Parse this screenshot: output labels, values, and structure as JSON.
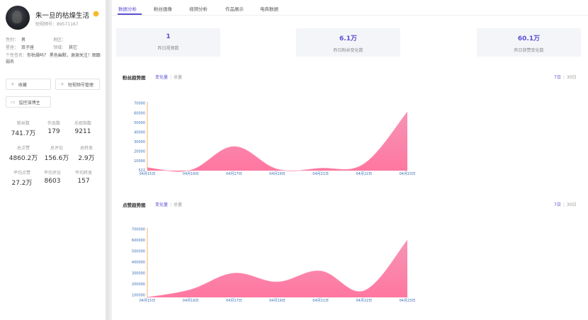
{
  "profile": {
    "nickname": "朱一旦的枯燥生活",
    "account_id": "短视频号：89571167"
  },
  "info": {
    "gender_label": "性别：",
    "gender_value": "男",
    "region_label": "地区：",
    "region_value": "",
    "constellation_label": "星座：",
    "constellation_value": "双子座",
    "field_label": "领域：",
    "field_value": "其它",
    "signature_label": "个性签名：",
    "signature_value": "你枯燥吗？ 黑色幽默，谢谢关注！图跟弱名"
  },
  "buttons": {
    "favorite": "收藏",
    "manage": "短视频号管理",
    "monitor": "监控该博主"
  },
  "stats": [
    {
      "label": "粉丝数",
      "value": "741.7万"
    },
    {
      "label": "作品数",
      "value": "179"
    },
    {
      "label": "乐观指数",
      "value": "9211"
    },
    {
      "label": "总点赞",
      "value": "4860.2万"
    },
    {
      "label": "总评论",
      "value": "156.6万"
    },
    {
      "label": "总转发",
      "value": "2.9万"
    },
    {
      "label": "平均点赞",
      "value": "27.2万"
    },
    {
      "label": "平均评论",
      "value": "8603"
    },
    {
      "label": "平均转发",
      "value": "157"
    }
  ],
  "tabs": [
    {
      "label": "数据分析",
      "active": true
    },
    {
      "label": "粉丝画像",
      "active": false
    },
    {
      "label": "视频分析",
      "active": false
    },
    {
      "label": "作品展示",
      "active": false
    },
    {
      "label": "电商数据",
      "active": false
    }
  ],
  "summary": [
    {
      "value": "1",
      "label": "昨日视频数"
    },
    {
      "value": "6.1万",
      "label": "昨日粉丝变化数"
    },
    {
      "value": "60.1万",
      "label": "昨日获赞变化数"
    }
  ],
  "fans_section": {
    "title": "粉丝趋势图",
    "toggle_on": "变化量",
    "toggle_off": "总量",
    "range_on": "7日",
    "range_off": "30日"
  },
  "likes_section": {
    "title": "点赞趋势图",
    "toggle_on": "变化量",
    "toggle_off": "总量",
    "range_on": "7日",
    "range_off": "30日"
  },
  "colors": {
    "accent": "#5b4fd1",
    "area_top": "#f7a0b6",
    "area_bottom": "#ff7aa3",
    "axis": "#f5a04a",
    "tick": "#3a6fb5"
  },
  "chart_data": [
    {
      "type": "area",
      "title": "",
      "x": [
        "04月15日",
        "04月16日",
        "04月17日",
        "04月19日",
        "04月21日",
        "04月22日",
        "04月23日"
      ],
      "values": [
        3000,
        522,
        25000,
        1500,
        2500,
        7000,
        61000
      ],
      "y_ticks": [
        "522",
        "10000",
        "20000",
        "30000",
        "40000",
        "50000",
        "60000",
        "70000"
      ],
      "ylim": [
        0,
        70000
      ]
    },
    {
      "type": "area",
      "title": "",
      "x": [
        "04月15日",
        "04月16日",
        "04月17日",
        "04月19日",
        "04月21日",
        "04月22日",
        "04月23日"
      ],
      "values": [
        80000,
        150000,
        300000,
        220000,
        320000,
        140000,
        600000
      ],
      "y_ticks": [
        "100000",
        "200000",
        "300000",
        "400000",
        "500000",
        "600000",
        "700000"
      ],
      "ylim": [
        80000,
        700000
      ]
    }
  ]
}
